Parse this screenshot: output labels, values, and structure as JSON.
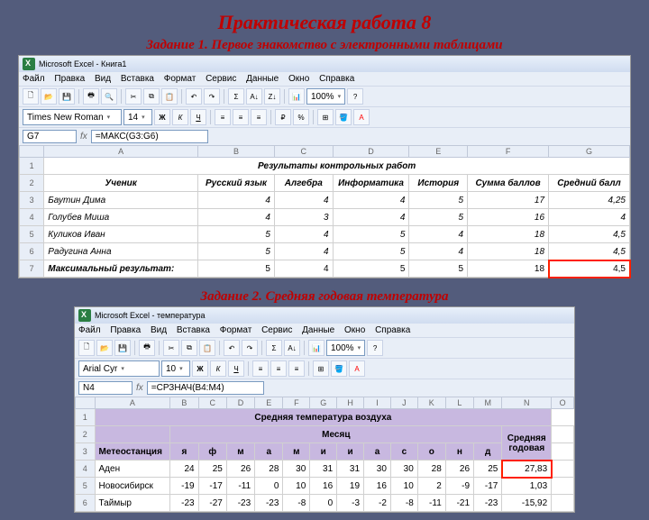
{
  "title": "Практическая работа 8",
  "task1": {
    "subtitle": "Задание 1. Первое знакомство с электронными таблицами",
    "window_title": "Microsoft Excel - Книга1",
    "menu": [
      "Файл",
      "Правка",
      "Вид",
      "Вставка",
      "Формат",
      "Сервис",
      "Данные",
      "Окно",
      "Справка"
    ],
    "font": "Times New Roman",
    "fontsize": "14",
    "zoom": "100%",
    "cellref": "G7",
    "formula": "=МАКС(G3:G6)",
    "cols": [
      "A",
      "B",
      "C",
      "D",
      "E",
      "F",
      "G"
    ],
    "heading": "Результаты контрольных работ",
    "headers": [
      "Ученик",
      "Русский язык",
      "Алгебра",
      "Информатика",
      "История",
      "Сумма баллов",
      "Средний балл"
    ],
    "rows": [
      {
        "n": "3",
        "name": "Баутин Дима",
        "v": [
          "4",
          "4",
          "4",
          "5",
          "17",
          "4,25"
        ]
      },
      {
        "n": "4",
        "name": "Голубев Миша",
        "v": [
          "4",
          "3",
          "4",
          "5",
          "16",
          "4"
        ]
      },
      {
        "n": "5",
        "name": "Куликов Иван",
        "v": [
          "5",
          "4",
          "5",
          "4",
          "18",
          "4,5"
        ]
      },
      {
        "n": "6",
        "name": "Радугина Анна",
        "v": [
          "5",
          "4",
          "5",
          "4",
          "18",
          "4,5"
        ]
      },
      {
        "n": "7",
        "name": "Максимальный результат:",
        "v": [
          "5",
          "4",
          "5",
          "5",
          "18",
          "4,5"
        ]
      }
    ]
  },
  "task2": {
    "subtitle": "Задание 2. Средняя годовая температура",
    "window_title": "Microsoft Excel - температура",
    "menu": [
      "Файл",
      "Правка",
      "Вид",
      "Вставка",
      "Формат",
      "Сервис",
      "Данные",
      "Окно",
      "Справка"
    ],
    "font": "Arial Cyr",
    "fontsize": "10",
    "zoom": "100%",
    "cellref": "N4",
    "formula": "=СРЗНАЧ(B4:M4)",
    "cols": [
      "A",
      "B",
      "C",
      "D",
      "E",
      "F",
      "G",
      "H",
      "I",
      "J",
      "K",
      "L",
      "M",
      "N",
      "O"
    ],
    "heading": "Средняя температура воздуха",
    "month_label": "Месяц",
    "annual_label": "Средняя годовая",
    "station_label": "Метеостанция",
    "months": [
      "я",
      "ф",
      "м",
      "а",
      "м",
      "и",
      "и",
      "а",
      "с",
      "о",
      "н",
      "д"
    ],
    "rows": [
      {
        "n": "4",
        "name": "Аден",
        "v": [
          "24",
          "25",
          "26",
          "28",
          "30",
          "31",
          "31",
          "30",
          "30",
          "28",
          "26",
          "25",
          "27,83"
        ]
      },
      {
        "n": "5",
        "name": "Новосибирск",
        "v": [
          "-19",
          "-17",
          "-11",
          "0",
          "10",
          "16",
          "19",
          "16",
          "10",
          "2",
          "-9",
          "-17",
          "1,03"
        ]
      },
      {
        "n": "6",
        "name": "Таймыр",
        "v": [
          "-23",
          "-27",
          "-23",
          "-23",
          "-8",
          "0",
          "-3",
          "-2",
          "-8",
          "-11",
          "-21",
          "-23",
          "-15,92"
        ]
      }
    ]
  },
  "chart_data": [
    {
      "type": "table",
      "title": "Результаты контрольных работ",
      "columns": [
        "Ученик",
        "Русский язык",
        "Алгебра",
        "Информатика",
        "История",
        "Сумма баллов",
        "Средний балл"
      ],
      "rows": [
        [
          "Баутин Дима",
          4,
          4,
          4,
          5,
          17,
          4.25
        ],
        [
          "Голубев Миша",
          4,
          3,
          4,
          5,
          16,
          4
        ],
        [
          "Куликов Иван",
          5,
          4,
          5,
          4,
          18,
          4.5
        ],
        [
          "Радугина Анна",
          5,
          4,
          5,
          4,
          18,
          4.5
        ],
        [
          "Максимальный результат:",
          5,
          4,
          5,
          5,
          18,
          4.5
        ]
      ]
    },
    {
      "type": "table",
      "title": "Средняя температура воздуха",
      "columns": [
        "Метеостанция",
        "я",
        "ф",
        "м",
        "а",
        "м",
        "и",
        "и",
        "а",
        "с",
        "о",
        "н",
        "д",
        "Средняя годовая"
      ],
      "rows": [
        [
          "Аден",
          24,
          25,
          26,
          28,
          30,
          31,
          31,
          30,
          30,
          28,
          26,
          25,
          27.83
        ],
        [
          "Новосибирск",
          -19,
          -17,
          -11,
          0,
          10,
          16,
          19,
          16,
          10,
          2,
          -9,
          -17,
          1.03
        ],
        [
          "Таймыр",
          -23,
          -27,
          -23,
          -23,
          -8,
          0,
          -3,
          -2,
          -8,
          -11,
          -21,
          -23,
          -15.92
        ]
      ]
    }
  ]
}
